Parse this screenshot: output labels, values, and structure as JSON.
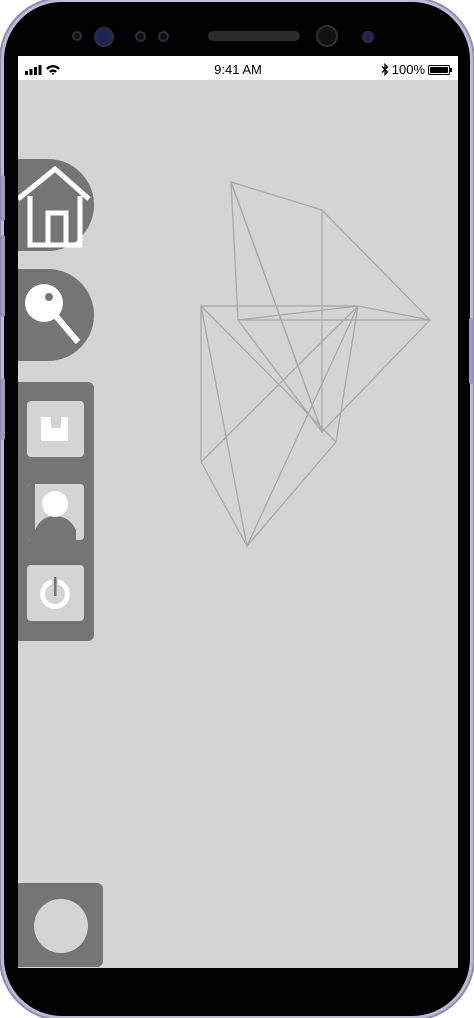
{
  "status_bar": {
    "time": "9:41 AM",
    "battery_percent": "100%",
    "battery_level": 1.0,
    "icons": [
      "signal-icon",
      "wifi-icon",
      "bluetooth-icon",
      "battery-icon"
    ]
  },
  "sidebar": {
    "buttons": [
      {
        "name": "home",
        "icon": "home-icon"
      },
      {
        "name": "search",
        "icon": "search-icon"
      }
    ],
    "panel_items": [
      {
        "name": "save",
        "icon": "save-icon"
      },
      {
        "name": "profile",
        "icon": "user-icon"
      },
      {
        "name": "power",
        "icon": "power-icon"
      }
    ]
  },
  "bottom_button": {
    "icon": "circle-icon"
  },
  "colors": {
    "screen_background": "#d4d4d4",
    "button_fill": "#767474",
    "icon_fill": "#ffffff",
    "wireframe_stroke": "#a8a8a8",
    "frame_accent": "#9c99bf"
  }
}
